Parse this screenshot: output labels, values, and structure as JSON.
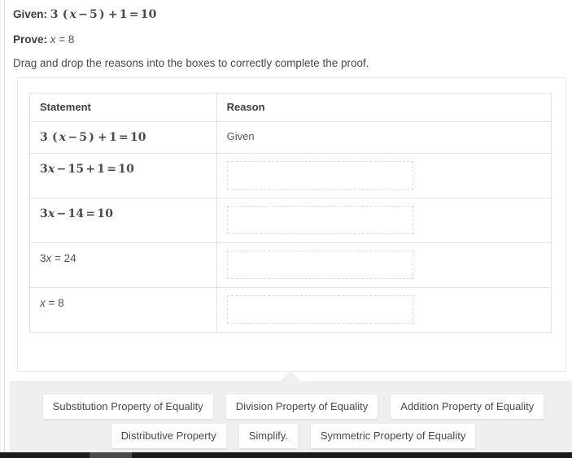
{
  "header": {
    "given_label": "Given:",
    "given_math": "3 (x − 5) + 1 = 10",
    "prove_label": "Prove:",
    "prove_math": "x = 8",
    "instructions": "Drag and drop the reasons into the boxes to correctly complete the proof."
  },
  "table": {
    "columns": [
      "Statement",
      "Reason"
    ],
    "rows": [
      {
        "statement": "3 (x − 5) + 1 = 10",
        "reason": "Given",
        "has_dropbox": false,
        "style": "math"
      },
      {
        "statement": "3x − 15 + 1 = 10",
        "reason": "",
        "has_dropbox": true,
        "style": "math"
      },
      {
        "statement": "3x − 14 = 10",
        "reason": "",
        "has_dropbox": true,
        "style": "math"
      },
      {
        "statement": "3x = 24",
        "reason": "",
        "has_dropbox": true,
        "style": "plain"
      },
      {
        "statement": "x = 8",
        "reason": "",
        "has_dropbox": true,
        "style": "plain"
      }
    ]
  },
  "tray": {
    "row1": [
      "Substitution Property of Equality",
      "Division Property of Equality",
      "Addition Property of Equality"
    ],
    "row2": [
      "Distributive Property",
      "Simplify.",
      "Symmetric Property of Equality"
    ]
  },
  "colors": {
    "text": "#4a4a4a",
    "border": "#e4e4e4",
    "tray_bg": "#efefef",
    "chip_bg": "#ffffff",
    "dropbox_border": "#dcdcdc",
    "bottombar": "#1b1b1b"
  }
}
